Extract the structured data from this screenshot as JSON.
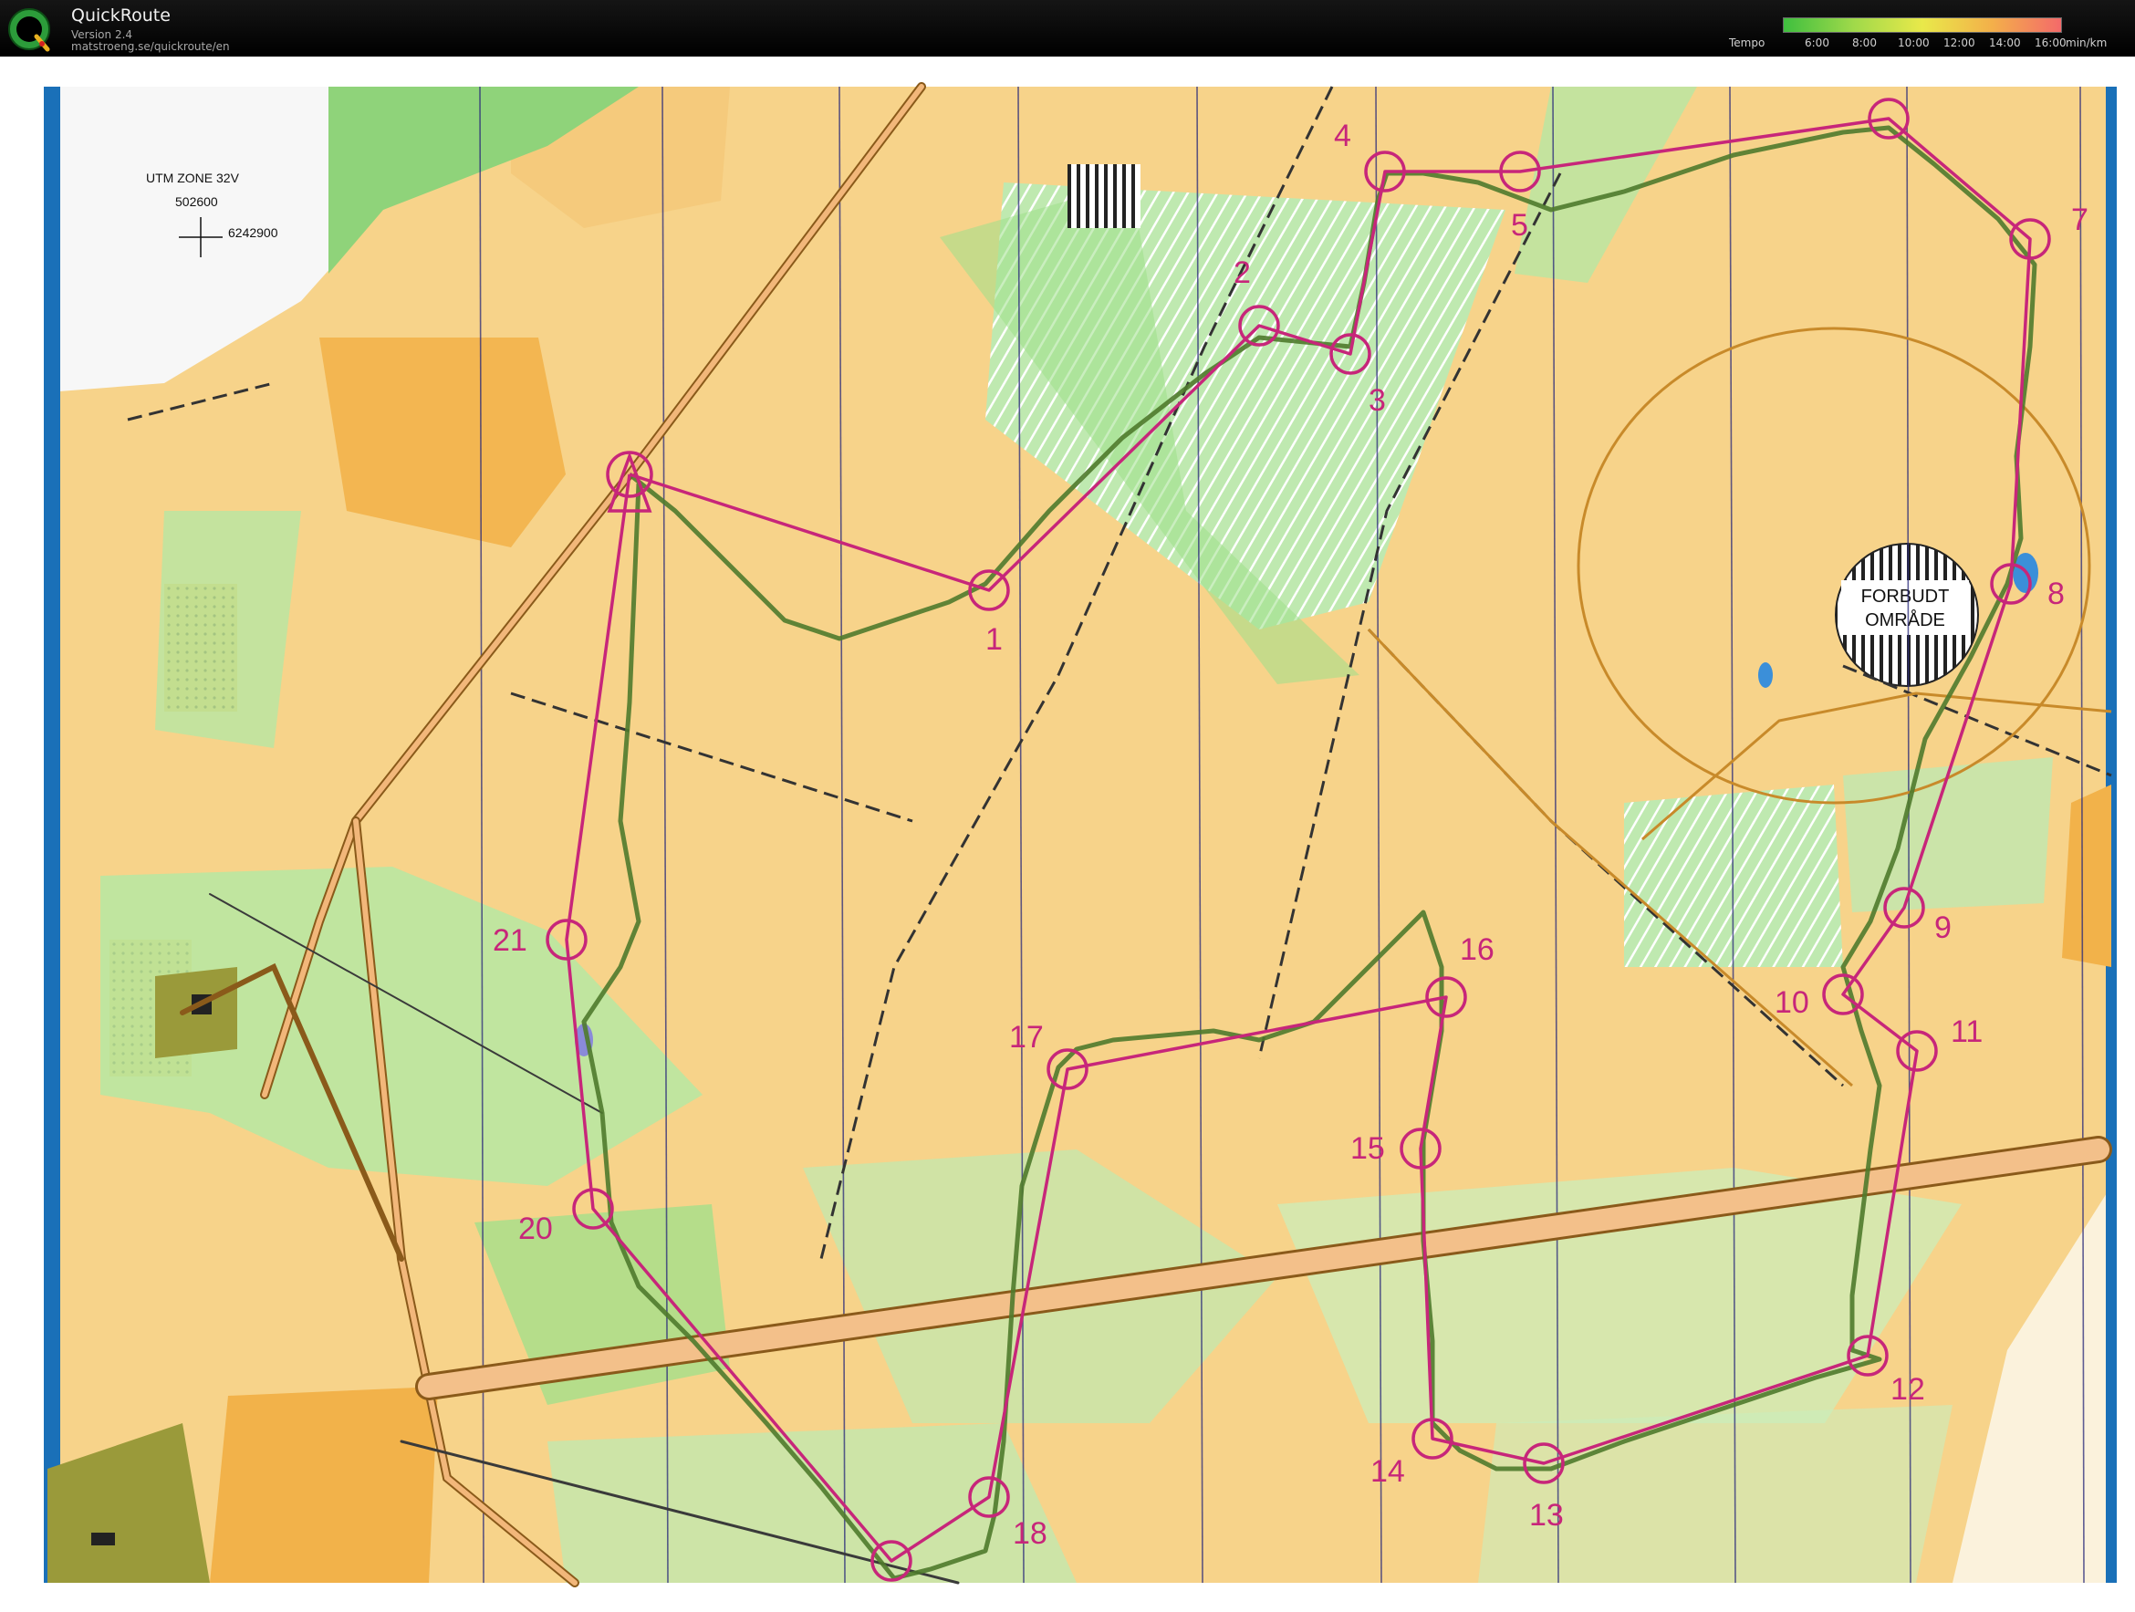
{
  "header": {
    "title": "QuickRoute",
    "version": "Version 2.4",
    "url": "matstroeng.se/quickroute/en",
    "logo_letter": "Q"
  },
  "tempo_legend": {
    "label": "Tempo",
    "unit": "min/km",
    "ticks": [
      "6:00",
      "8:00",
      "10:00",
      "12:00",
      "14:00",
      "16:00"
    ],
    "colors": [
      "#3fbf3f",
      "#9fd94a",
      "#e9e94a",
      "#f3b04a",
      "#f36a6a"
    ]
  },
  "map": {
    "grid_info": {
      "zone": "UTM ZONE 32V",
      "easting": "502600",
      "northing": "6242900"
    },
    "restricted_area": [
      "FORBUDT",
      "OMRÅDE"
    ],
    "controls": [
      "1",
      "2",
      "3",
      "4",
      "5",
      "7",
      "8",
      "9",
      "10",
      "11",
      "12",
      "13",
      "14",
      "15",
      "16",
      "17",
      "18",
      "20",
      "21"
    ],
    "colors": {
      "course": "#c7267a",
      "route": "#4f7a2c",
      "open_land": "#f7d38a",
      "forest_green": "#8fd37a",
      "water": "#3b8fd9",
      "border_blue": "#1a70b8"
    }
  }
}
